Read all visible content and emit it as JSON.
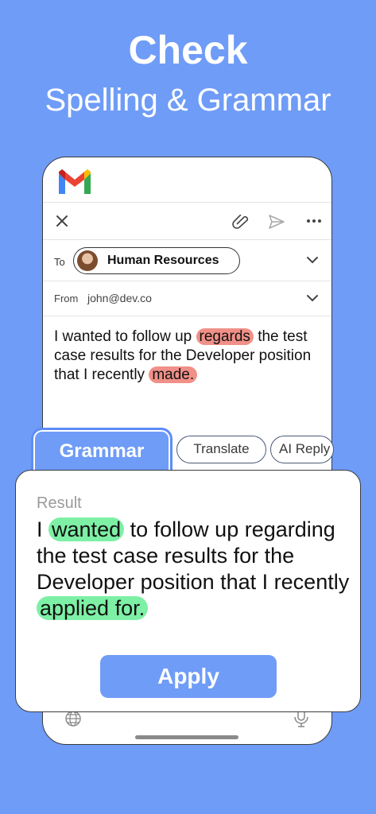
{
  "headline": {
    "line1": "Check",
    "line2": "Spelling & Grammar"
  },
  "compose": {
    "to_label": "To",
    "recipient": "Human Resources",
    "from_label": "From",
    "from_value": "john@dev.co",
    "body": {
      "p1": "I wanted to follow up",
      "err1": "regards",
      "p2": "the test case results for the Developer position that I recently",
      "err2": "made."
    }
  },
  "tabs": {
    "grammar": "Grammar",
    "translate": "Translate",
    "ai_reply": "AI Reply"
  },
  "result": {
    "label": "Result",
    "p1": "I",
    "fix1": "wanted",
    "p2": "to follow up regarding the test case results for the Developer position that I recently",
    "fix2": "applied for."
  },
  "apply_label": "Apply",
  "colors": {
    "background": "#6f9cf7",
    "error_highlight": "#f09088",
    "fix_highlight": "#7df0a5"
  }
}
